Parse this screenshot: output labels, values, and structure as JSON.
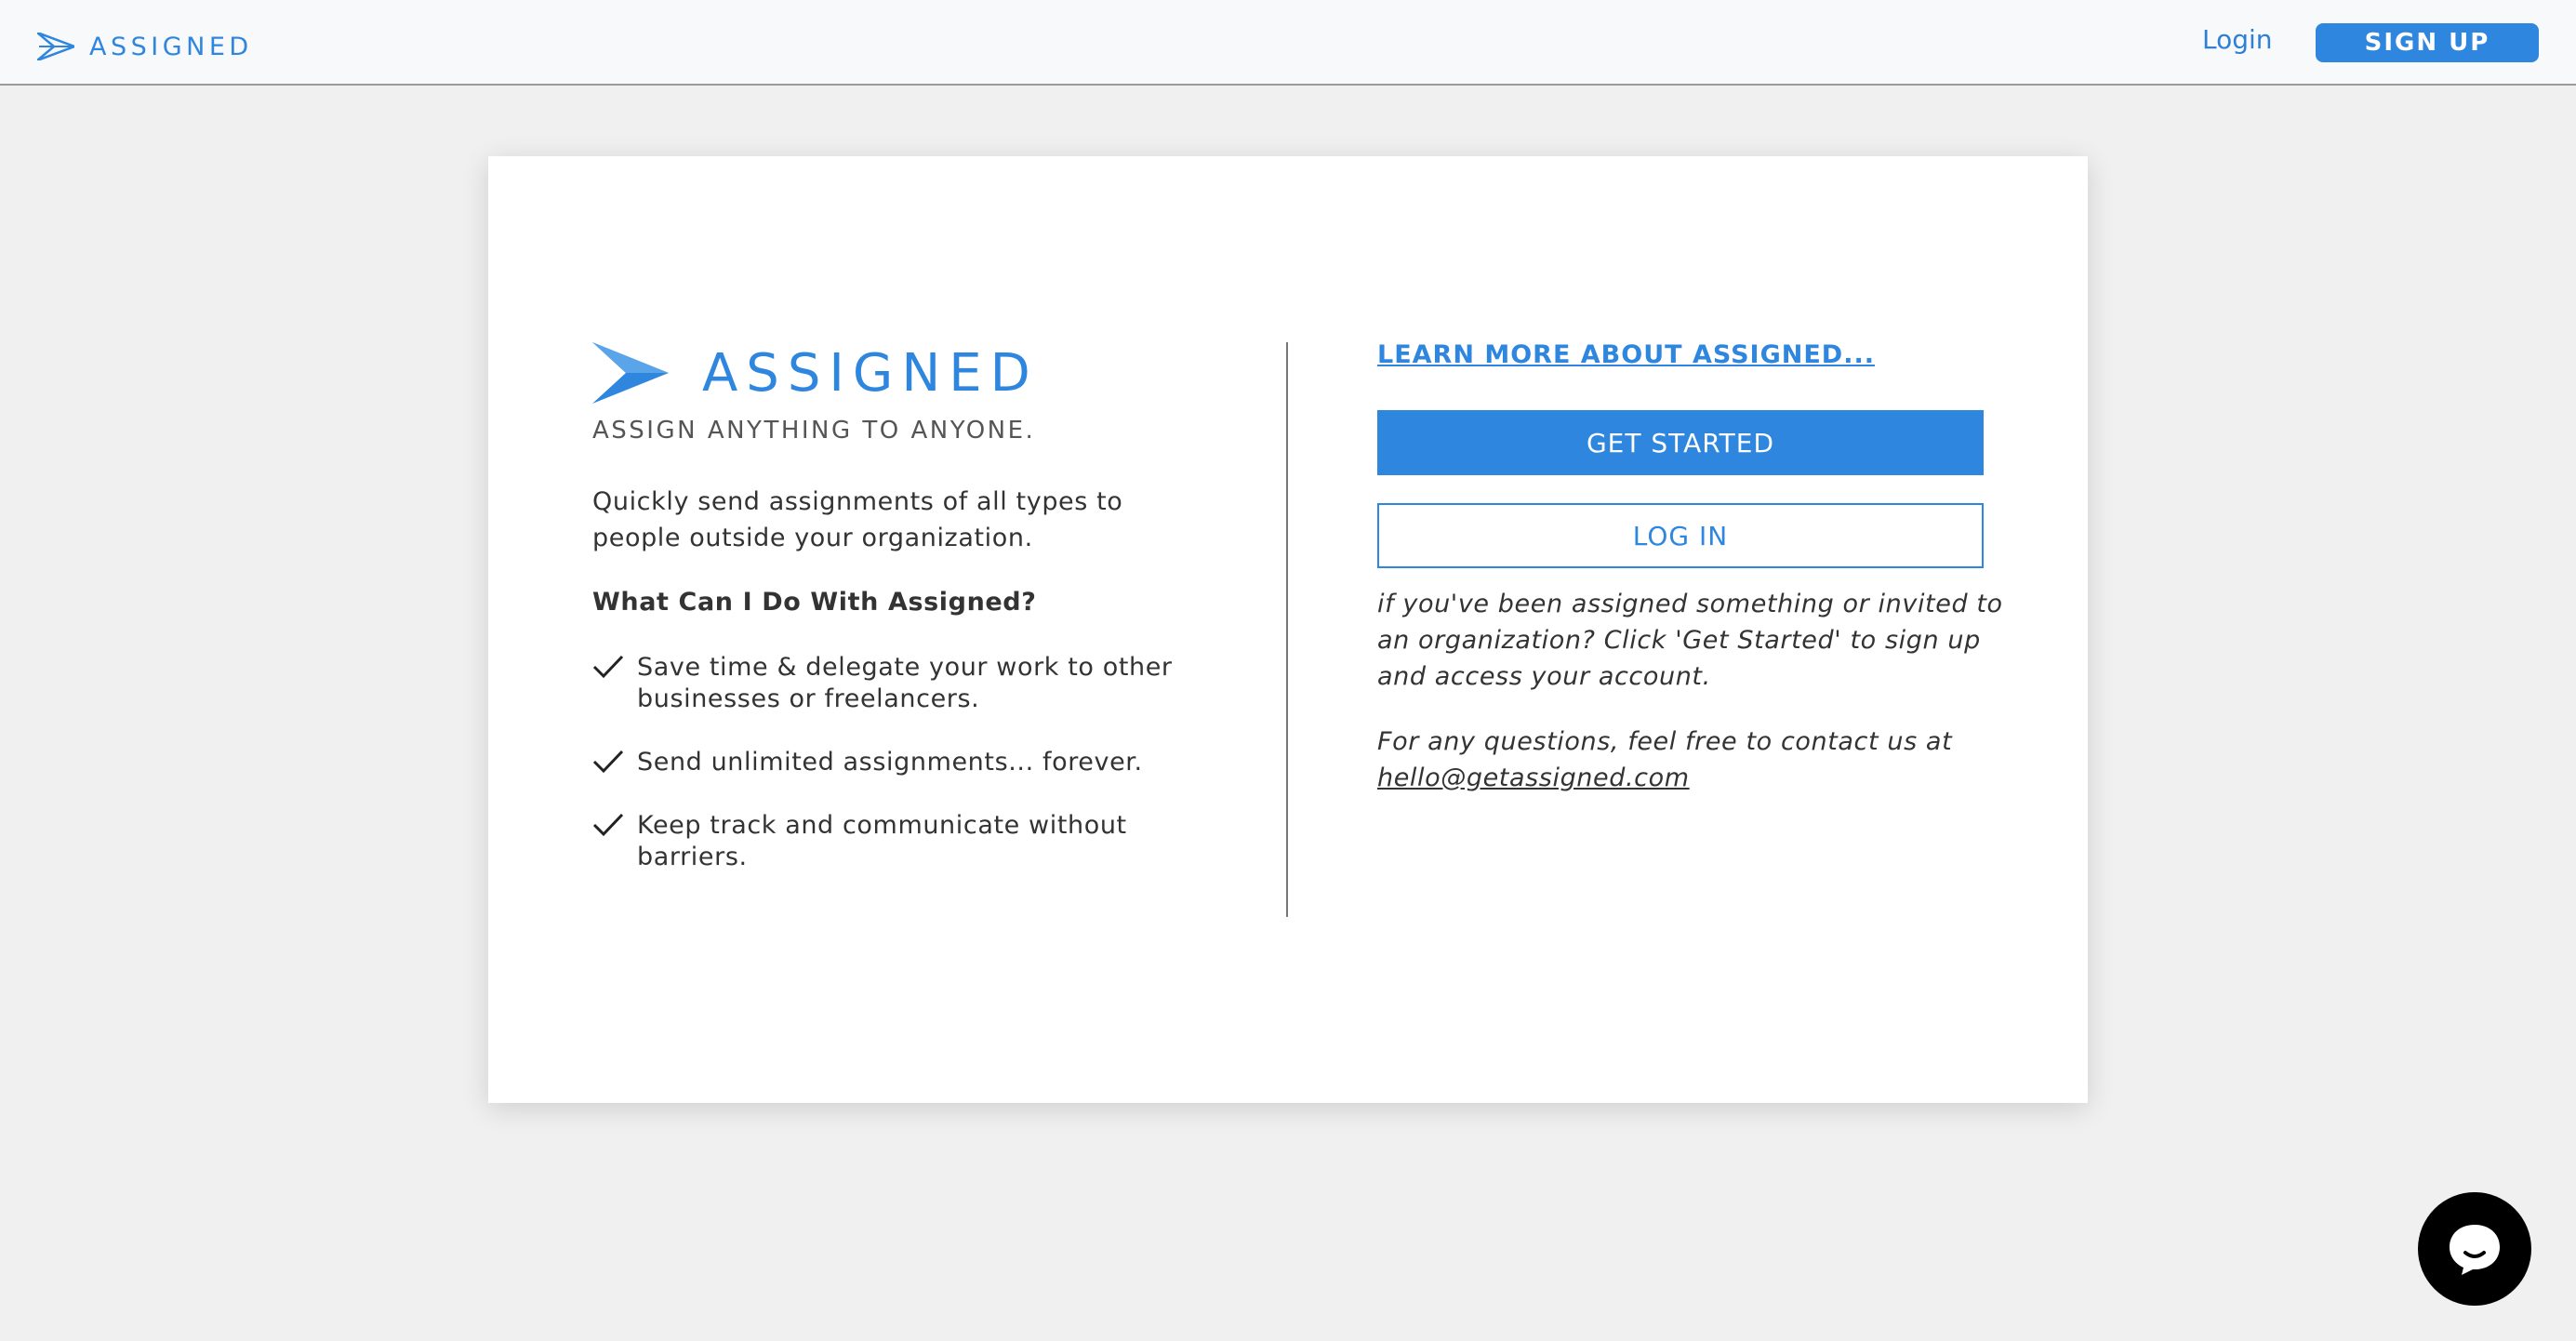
{
  "header": {
    "brand": "ASSIGNED",
    "login_label": "Login",
    "signup_label": "SIGN UP",
    "accent": "#2e86de"
  },
  "card": {
    "logo_text": "ASSIGNED",
    "tagline": "ASSIGN ANYTHING TO ANYONE.",
    "intro": "Quickly send assignments of all types to people outside your organization.",
    "features_heading": "What Can I Do With Assigned?",
    "features": [
      {
        "icon": "checkmark-icon",
        "text": "Save time & delegate your work to other businesses or freelancers."
      },
      {
        "icon": "checkmark-icon",
        "text": "Send unlimited assignments... forever."
      },
      {
        "icon": "checkmark-icon",
        "text": "Keep track and communicate without barriers."
      }
    ],
    "learn_more_label": "LEARN MORE ABOUT ASSIGNED...",
    "get_started_label": "GET STARTED",
    "login_label": "LOG IN",
    "note": "if you've been assigned something or invited to an organization? Click 'Get Started' to sign up and access your account.",
    "contact_text": "For any questions, feel free to contact us at",
    "contact_email": "hello@getassigned.com"
  },
  "chat": {
    "icon": "chat-bubble-icon"
  }
}
